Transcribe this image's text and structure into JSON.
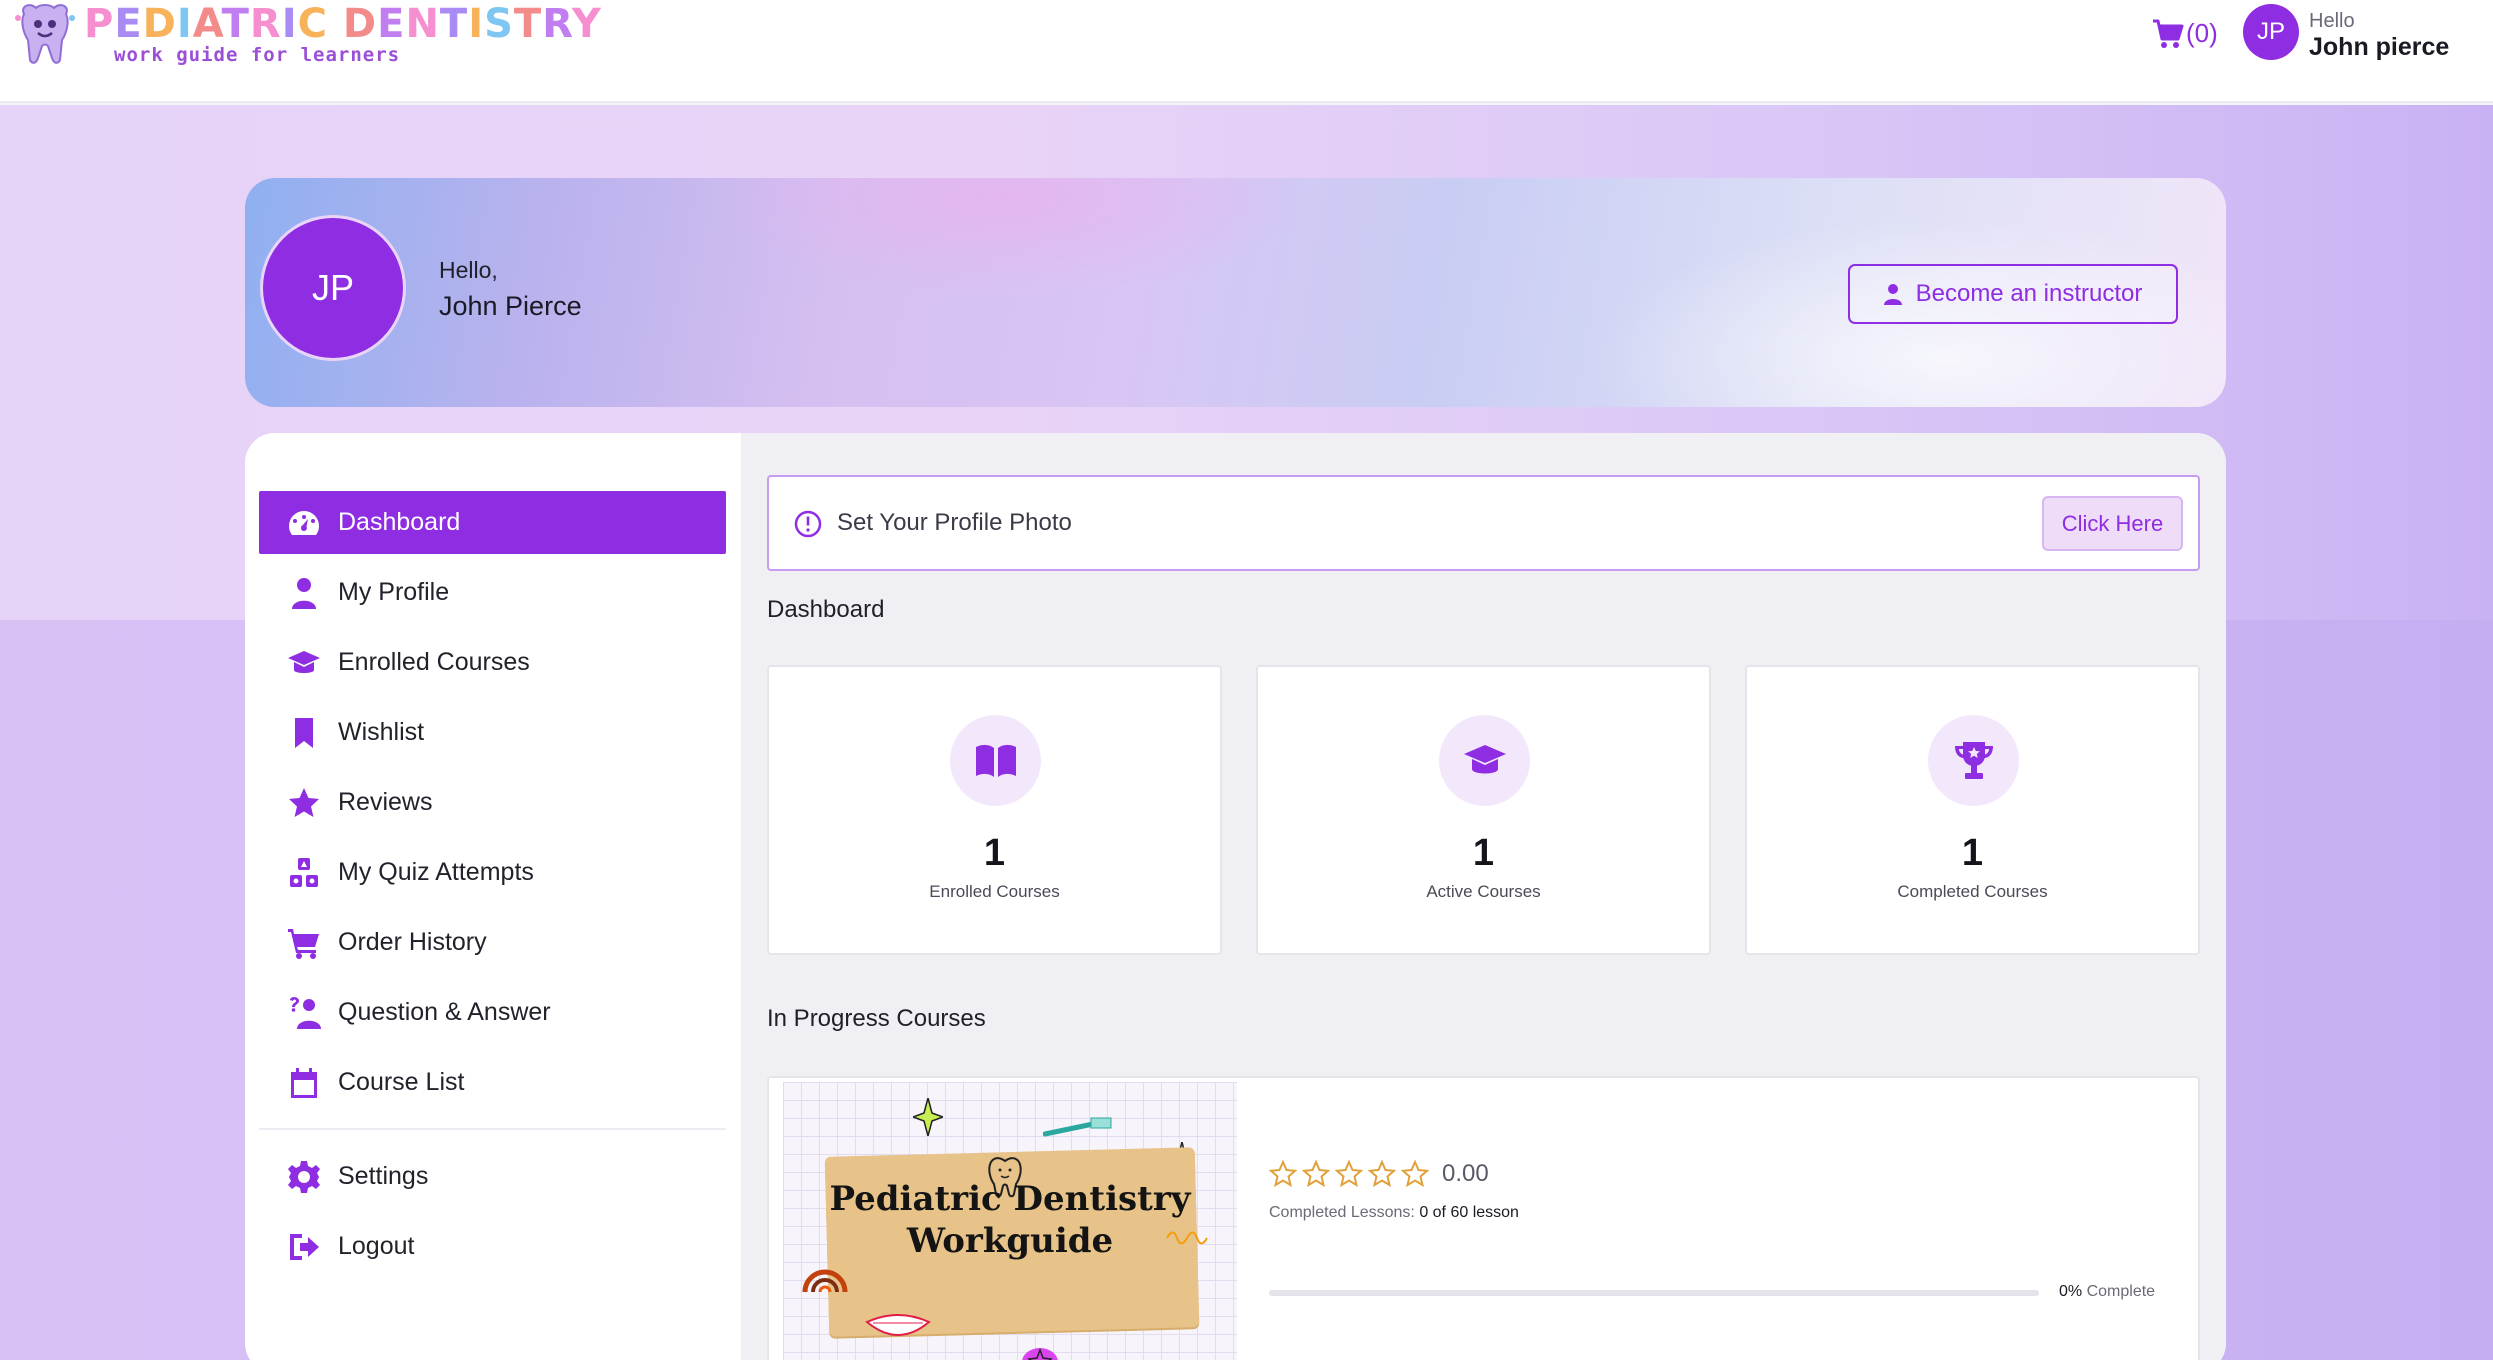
{
  "brand": {
    "title_letters": [
      "P",
      "E",
      "D",
      "I",
      "A",
      "T",
      "R",
      "I",
      "C",
      " ",
      "D",
      "E",
      "N",
      "T",
      "I",
      "S",
      "T",
      "R",
      "Y"
    ],
    "subtitle": "work guide for learners"
  },
  "header": {
    "cart_count": "(0)",
    "avatar_initials": "JP",
    "greeting": "Hello",
    "user_name": "John pierce"
  },
  "hero": {
    "avatar_initials": "JP",
    "greeting": "Hello,",
    "user_name": "John Pierce",
    "instructor_button": "Become an instructor"
  },
  "sidebar": {
    "items": [
      {
        "label": "Dashboard",
        "icon": "dashboard-icon",
        "active": true
      },
      {
        "label": "My Profile",
        "icon": "user-icon",
        "active": false
      },
      {
        "label": "Enrolled Courses",
        "icon": "graduation-cap-icon",
        "active": false
      },
      {
        "label": "Wishlist",
        "icon": "bookmark-icon",
        "active": false
      },
      {
        "label": "Reviews",
        "icon": "star-icon",
        "active": false
      },
      {
        "label": "My Quiz Attempts",
        "icon": "cubes-icon",
        "active": false
      },
      {
        "label": "Order History",
        "icon": "cart-icon",
        "active": false
      },
      {
        "label": "Question & Answer",
        "icon": "question-person-icon",
        "active": false
      },
      {
        "label": "Course List",
        "icon": "calendar-icon",
        "active": false
      },
      {
        "label": "Settings",
        "icon": "gear-icon",
        "active": false
      },
      {
        "label": "Logout",
        "icon": "logout-icon",
        "active": false
      }
    ]
  },
  "alert": {
    "text": "Set Your Profile Photo",
    "button": "Click Here"
  },
  "dashboard": {
    "title": "Dashboard",
    "stats": [
      {
        "value": "1",
        "label": "Enrolled Courses",
        "icon": "book-open-icon"
      },
      {
        "value": "1",
        "label": "Active Courses",
        "icon": "graduation-cap-icon"
      },
      {
        "value": "1",
        "label": "Completed Courses",
        "icon": "trophy-icon"
      }
    ]
  },
  "in_progress": {
    "title": "In Progress Courses",
    "course": {
      "thumbnail_title_line1": "Pediatric Dentistry",
      "thumbnail_title_line2": "Workguide",
      "rating": "0.00",
      "stars_filled": 0,
      "stars_total": 5,
      "lessons_label": "Completed Lessons:",
      "lessons_value": "0 of 60 lesson",
      "progress_percent": 0,
      "progress_pct_label": "0%",
      "progress_suffix": "Complete"
    }
  },
  "colors": {
    "accent": "#8e2de2",
    "star": "#e0a13a"
  }
}
